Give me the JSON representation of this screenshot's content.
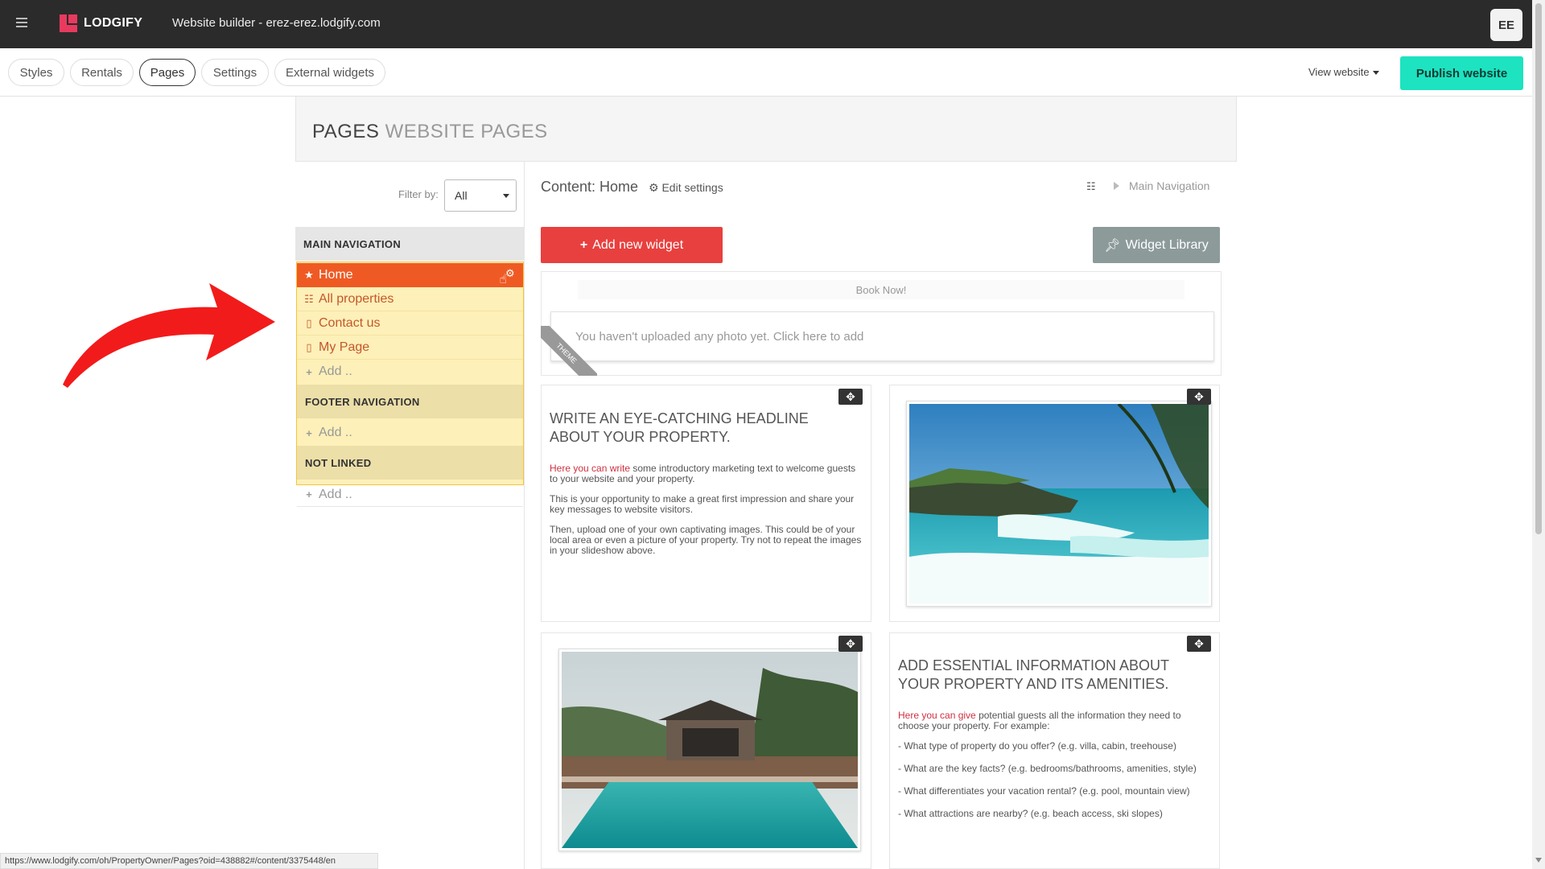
{
  "topbar": {
    "brand": "LODGIFY",
    "title": "Website builder - erez-erez.lodgify.com",
    "avatar": "EE"
  },
  "tabs": [
    {
      "label": "Styles"
    },
    {
      "label": "Rentals"
    },
    {
      "label": "Pages",
      "active": true
    },
    {
      "label": "Settings"
    },
    {
      "label": "External widgets"
    }
  ],
  "toolbar": {
    "view_website": "View website",
    "publish": "Publish website"
  },
  "page_header": {
    "title": "PAGES",
    "subtitle": "WEBSITE PAGES"
  },
  "left_panel": {
    "filter_label": "Filter by:",
    "filter_value": "All",
    "main_nav": {
      "heading": "MAIN NAVIGATION",
      "items": [
        {
          "label": "Home",
          "icon": "star-icon"
        },
        {
          "label": "All properties",
          "icon": "sitemap-icon"
        },
        {
          "label": "Contact us",
          "icon": "page-icon"
        },
        {
          "label": "My Page",
          "icon": "page-icon"
        }
      ],
      "add": "Add .."
    },
    "footer_nav": {
      "heading": "FOOTER NAVIGATION",
      "add": "Add .."
    },
    "not_linked": {
      "heading": "NOT LINKED",
      "add": "Add .."
    }
  },
  "content": {
    "title": "Content: Home",
    "edit_settings": "Edit settings",
    "breadcrumb": "Main Navigation",
    "add_widget": "Add new widget",
    "widget_library": "Widget Library",
    "book_now": "Book Now!",
    "photo_hint": "You haven't uploaded any photo yet. Click here to add",
    "theme_badge": "THEME",
    "block1": {
      "headline": "WRITE AN EYE-CATCHING HEADLINE ABOUT YOUR PROPERTY.",
      "p1_red": "Here you can write",
      "p1_rest": " some introductory marketing text to welcome guests to your website and your property.",
      "p2": "This is your opportunity to make a great first impression and share your key messages to website visitors.",
      "p3": "Then, upload one of your own captivating images. This could be of your local area or even a picture of your property. Try not to repeat the images in your slideshow above."
    },
    "block2": {
      "headline": "ADD ESSENTIAL INFORMATION ABOUT YOUR PROPERTY AND ITS AMENITIES.",
      "p1_red": "Here you can give",
      "p1_rest": " potential guests all the information they need to choose your property. For example:",
      "bullets": [
        "- What type of property do you offer? (e.g. villa, cabin, treehouse)",
        "- What are the key facts? (e.g. bedrooms/bathrooms, amenities, style)",
        "- What differentiates your vacation rental? (e.g. pool, mountain view)",
        "- What attractions are nearby? (e.g. beach access, ski slopes)"
      ]
    }
  },
  "status_url": "https://www.lodgify.com/oh/PropertyOwner/Pages?oid=438882#/content/3375448/en",
  "colors": {
    "topbar": "#2b2b2b",
    "publish": "#1de3c0",
    "home_active": "#ef5a24",
    "add_widget": "#e8403f",
    "nav_highlight": "#fdf0b8"
  }
}
